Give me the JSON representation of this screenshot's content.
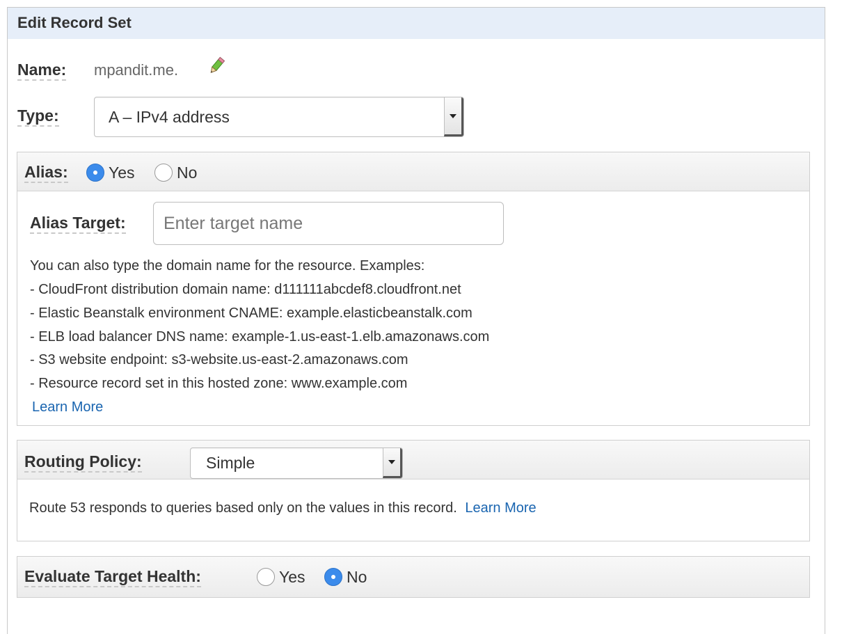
{
  "header": {
    "title": "Edit Record Set"
  },
  "name": {
    "label": "Name:",
    "value": "mpandit.me."
  },
  "type": {
    "label": "Type:",
    "value": "A – IPv4 address"
  },
  "alias": {
    "label": "Alias:",
    "yes_label": "Yes",
    "no_label": "No",
    "selected": "Yes",
    "target_label": "Alias Target:",
    "target_placeholder": "Enter target name",
    "intro": "You can also type the domain name for the resource. Examples:",
    "examples": [
      "-  CloudFront distribution domain name: d111111abcdef8.cloudfront.net",
      "-  Elastic Beanstalk environment CNAME: example.elasticbeanstalk.com",
      "-  ELB load balancer DNS name: example-1.us-east-1.elb.amazonaws.com",
      "-  S3 website endpoint: s3-website.us-east-2.amazonaws.com",
      "-  Resource record set in this hosted zone: www.example.com"
    ],
    "learn_more": "Learn More"
  },
  "routing": {
    "label": "Routing Policy:",
    "value": "Simple",
    "description": "Route 53 responds to queries based only on the values in this record.",
    "learn_more": "Learn More"
  },
  "health": {
    "label": "Evaluate Target Health:",
    "yes_label": "Yes",
    "no_label": "No",
    "selected": "No"
  },
  "colors": {
    "header_bg": "#e6eef9",
    "radio_selected": "#3b8beb",
    "link": "#1a65b0"
  },
  "icons": {
    "edit": "pencil-icon",
    "dropdown": "chevron-down-icon"
  }
}
